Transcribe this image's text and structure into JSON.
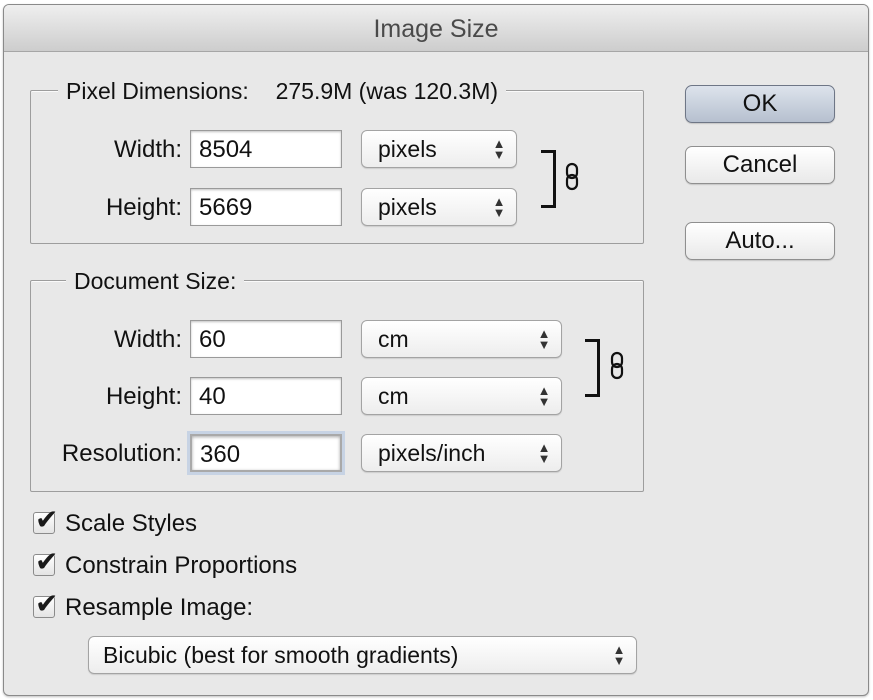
{
  "window": {
    "title": "Image Size"
  },
  "pixel_dimensions": {
    "legend_label": "Pixel Dimensions:",
    "size_text": "275.9M (was 120.3M)",
    "width_label": "Width:",
    "width_value": "8504",
    "width_unit": "pixels",
    "height_label": "Height:",
    "height_value": "5669",
    "height_unit": "pixels"
  },
  "document_size": {
    "legend_label": "Document Size:",
    "width_label": "Width:",
    "width_value": "60",
    "width_unit": "cm",
    "height_label": "Height:",
    "height_value": "40",
    "height_unit": "cm",
    "resolution_label": "Resolution:",
    "resolution_value": "360",
    "resolution_unit": "pixels/inch"
  },
  "buttons": {
    "ok_label": "OK",
    "cancel_label": "Cancel",
    "auto_label": "Auto..."
  },
  "options": {
    "scale_styles": {
      "label": "Scale Styles",
      "checked": true
    },
    "constrain_proportions": {
      "label": "Constrain Proportions",
      "checked": true
    },
    "resample_image": {
      "label": "Resample Image:",
      "checked": true
    },
    "resample_method": "Bicubic (best for smooth gradients)"
  },
  "icons": {
    "link_icon": "chain-link-icon",
    "checkmark": "✔",
    "updown_arrows": "▲▼"
  },
  "colors": {
    "dialog_background": "#e8e8e8",
    "default_button": "#b6c0cf",
    "focus_ring": "#c7d3e4"
  }
}
